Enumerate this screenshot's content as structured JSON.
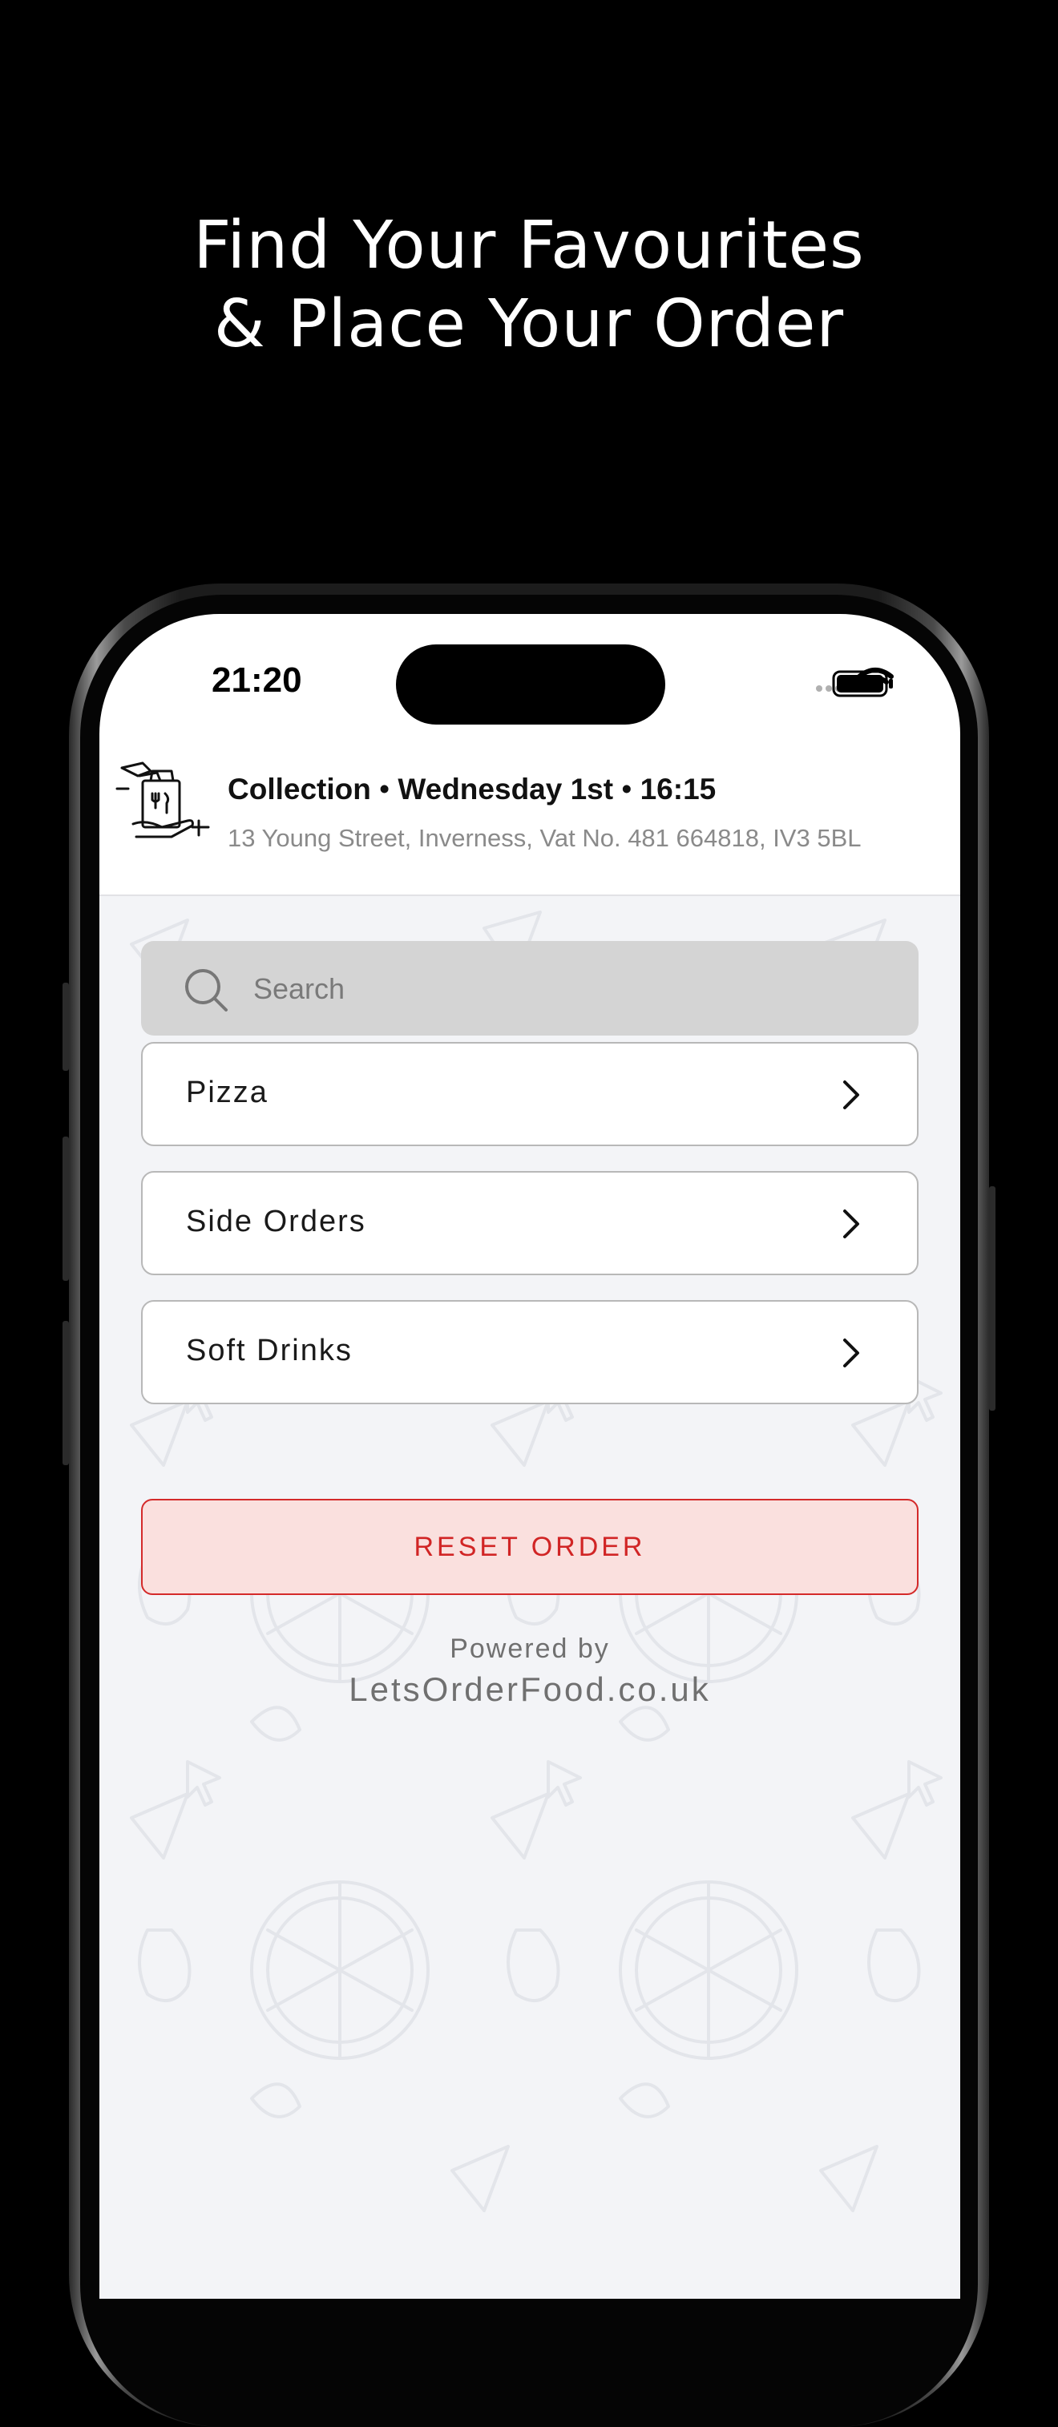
{
  "promo": {
    "headline_line1": "Find Your Favourites",
    "headline_line2": "& Place Your Order"
  },
  "status_bar": {
    "time": "21:20",
    "icons": [
      "signal-dots-icon",
      "wifi-icon",
      "battery-icon"
    ]
  },
  "header": {
    "icon": "collection-bag-icon",
    "mode": "Collection",
    "separator": "•",
    "day": "Wednesday 1st",
    "time": "16:15",
    "address": "13 Young Street, Inverness, Vat No. 481 664818, IV3  5BL"
  },
  "search": {
    "placeholder": "Search",
    "value": ""
  },
  "categories": [
    {
      "label": "Pizza"
    },
    {
      "label": "Side Orders"
    },
    {
      "label": "Soft Drinks"
    }
  ],
  "reset_button": {
    "label": "RESET ORDER"
  },
  "footer": {
    "powered_by": "Powered by",
    "site": "LetsOrderFood.co.uk"
  },
  "colors": {
    "page_background": "#000000",
    "screen_background": "#f3f4f7",
    "search_background": "#d4d4d4",
    "reset_text": "#d12525",
    "reset_background": "#fae0de",
    "reset_border": "#d42a2a"
  }
}
